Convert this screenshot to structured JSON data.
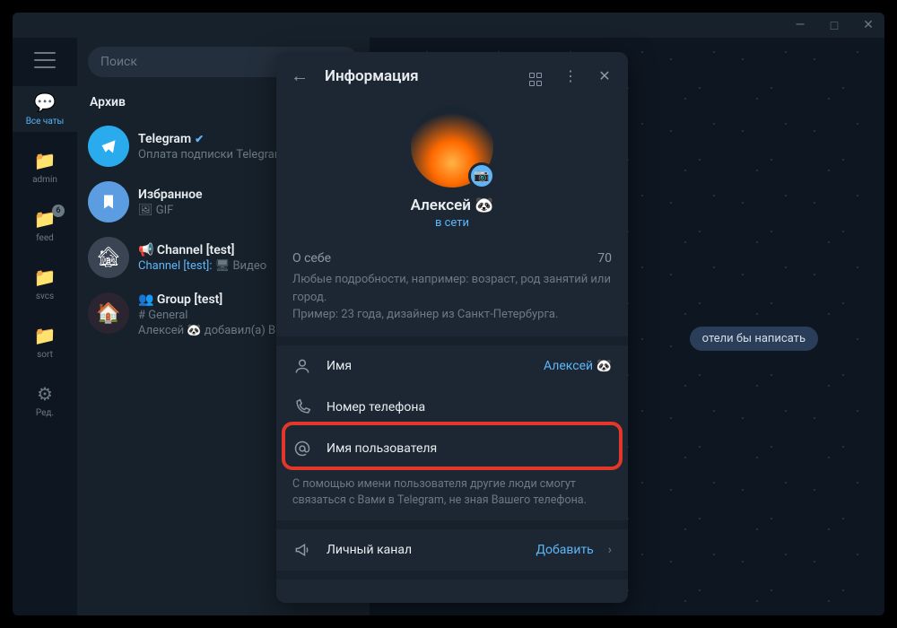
{
  "window": {
    "minimize": "—",
    "maximize": "□",
    "close": "✕"
  },
  "search": {
    "placeholder": "Поиск"
  },
  "rail": {
    "all_label": "Все чаты",
    "admin": "admin",
    "feed": "feed",
    "feed_badge": "6",
    "svcs": "svcs",
    "sort": "sort",
    "edit": "Ред."
  },
  "chatlist": {
    "archive": "Архив",
    "items": [
      {
        "title": "Telegram",
        "sub": "Оплата подписки Telegram"
      },
      {
        "title": "Избранное",
        "sub": "🖼 GIF"
      },
      {
        "title": "📢 Channel [test]",
        "link": "Channel [test]:",
        "sub": " 🖥 Видео"
      },
      {
        "title": "👥 Group [test]",
        "hash": "# General",
        "sub": "Алексей 🐼 добавил(а) В"
      }
    ]
  },
  "hint": "отели бы написать",
  "panel": {
    "title": "Информация",
    "name": "Алексей 🐼",
    "status": "в сети",
    "bio_label": "О себе",
    "bio_count": "70",
    "bio_hint": "Любые подробности, например: возраст, род занятий или город.\nПример: 23 года, дизайнер из Санкт-Петербурга.",
    "name_label": "Имя",
    "name_value": "Алексей 🐼",
    "phone_label": "Номер телефона",
    "username_label": "Имя пользователя",
    "username_desc": "С помощью имени пользователя другие люди смогут связаться с Вами в Telegram, не зная Вашего телефона.",
    "channel_label": "Личный канал",
    "channel_action": "Добавить"
  }
}
